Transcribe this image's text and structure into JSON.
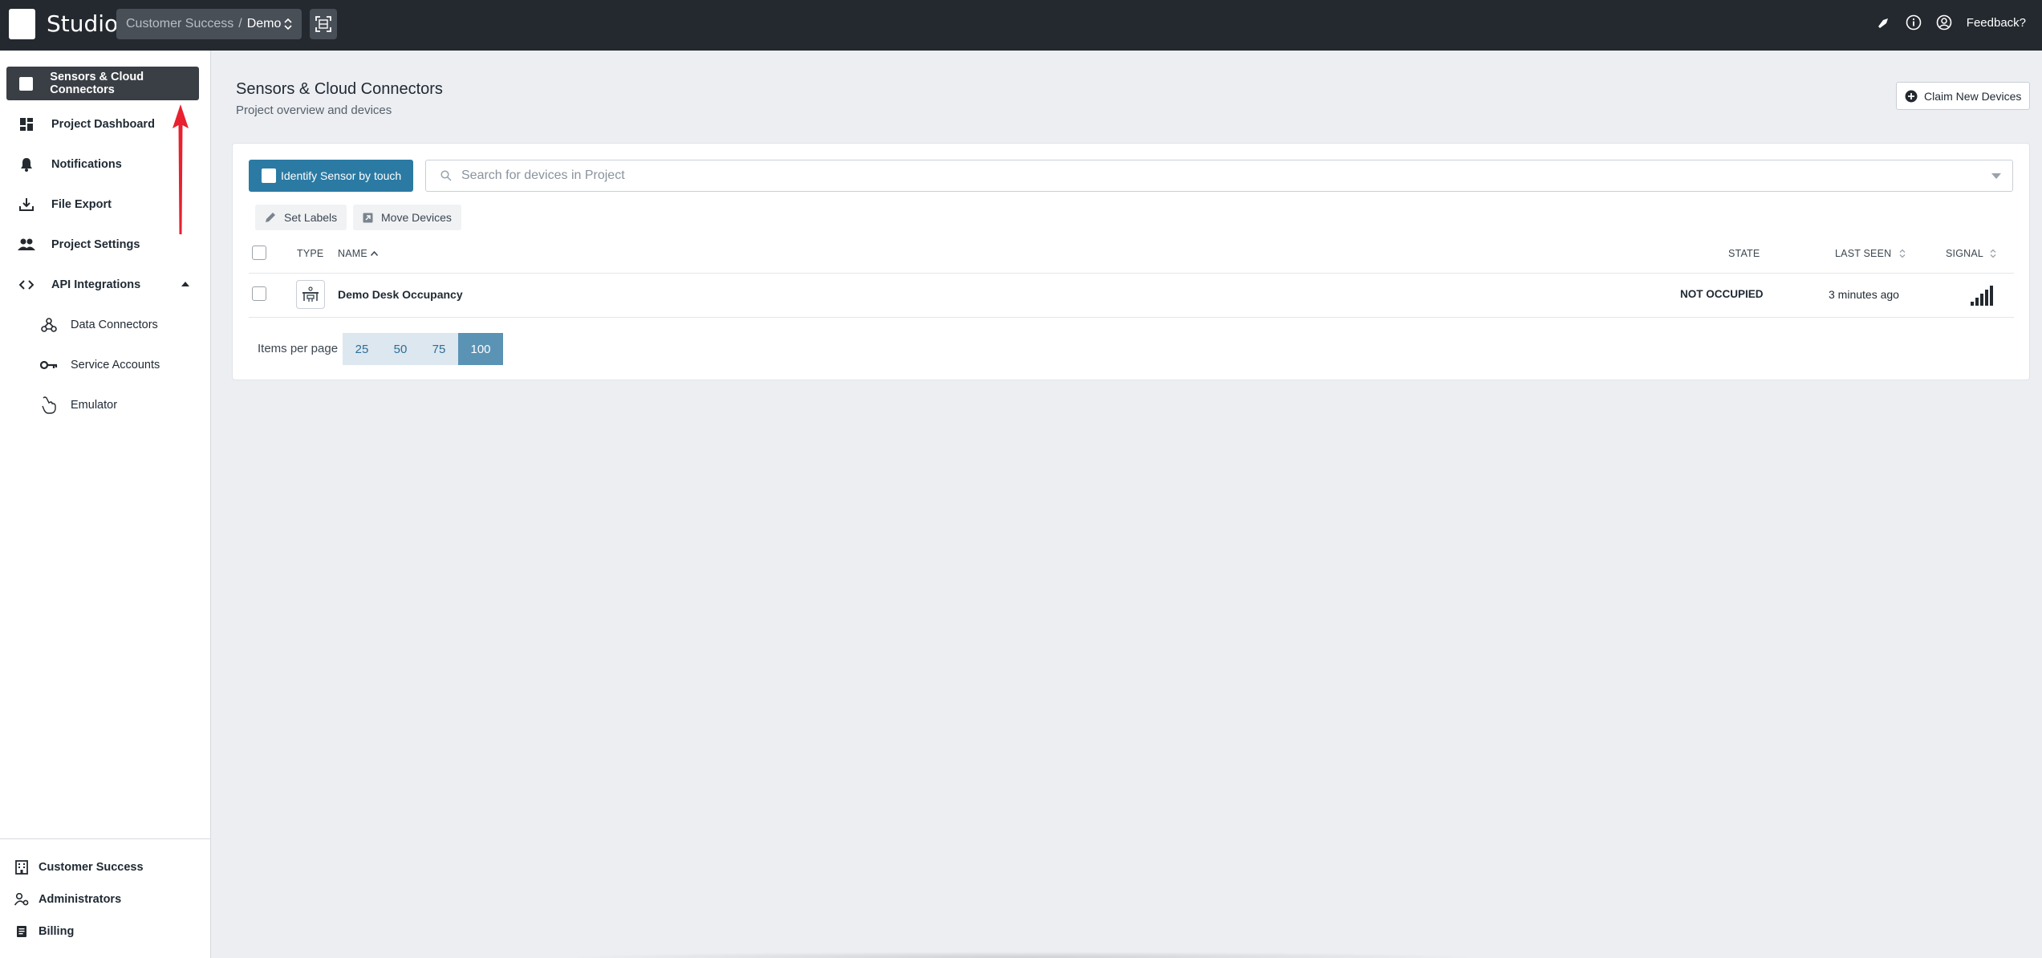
{
  "header": {
    "app_title": "Studio",
    "org": "Customer Success",
    "separator": "/",
    "project": "Demo",
    "feedback": "Feedback?"
  },
  "sidebar": {
    "items": [
      {
        "label": "Sensors & Cloud Connectors",
        "icon": "square-icon"
      },
      {
        "label": "Project Dashboard",
        "icon": "dashboard-icon"
      },
      {
        "label": "Notifications",
        "icon": "bell-icon"
      },
      {
        "label": "File Export",
        "icon": "download-icon"
      },
      {
        "label": "Project Settings",
        "icon": "people-icon"
      },
      {
        "label": "API Integrations",
        "icon": "code-icon"
      },
      {
        "label": "Data Connectors",
        "icon": "webhook-icon"
      },
      {
        "label": "Service Accounts",
        "icon": "key-icon"
      },
      {
        "label": "Emulator",
        "icon": "hand-pointer-icon"
      }
    ],
    "footer": [
      {
        "label": "Customer Success",
        "icon": "building-icon"
      },
      {
        "label": "Administrators",
        "icon": "admin-icon"
      },
      {
        "label": "Billing",
        "icon": "receipt-icon"
      }
    ]
  },
  "main": {
    "title": "Sensors & Cloud Connectors",
    "subtitle": "Project overview and devices",
    "claim_button": "Claim New Devices",
    "identify_button": "Identify Sensor by touch",
    "search_placeholder": "Search for devices in Project",
    "set_labels": "Set Labels",
    "move_devices": "Move Devices",
    "columns": {
      "type": "TYPE",
      "name": "NAME",
      "state": "STATE",
      "last_seen": "LAST SEEN",
      "signal": "SIGNAL"
    },
    "rows": [
      {
        "name": "Demo Desk Occupancy",
        "state": "NOT OCCUPIED",
        "last_seen": "3 minutes ago",
        "signal_bars": 5
      }
    ],
    "items_per_page_label": "Items per page",
    "page_sizes": [
      "25",
      "50",
      "75",
      "100"
    ],
    "selected_page_size": "100"
  },
  "colors": {
    "topbar": "#24292f",
    "accent": "#2b7aa3",
    "active_nav": "#3a3f45",
    "arrow": "#e8202f"
  }
}
